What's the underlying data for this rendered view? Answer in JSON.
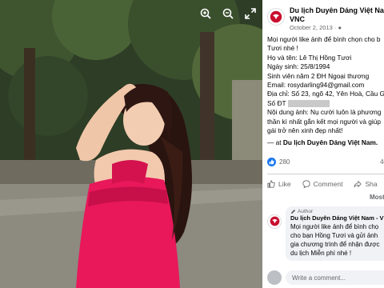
{
  "viewer": {
    "controls": [
      "zoom-in-icon",
      "zoom-out-icon",
      "fullscreen-icon"
    ]
  },
  "post": {
    "page_name_line1": "Du lịch Duyên Dáng Việt Nam -",
    "page_name_line2": "VNC",
    "date": "October 2, 2013 · ",
    "body": [
      "Mọi người like ảnh để bình chọn cho b",
      "Tươi nhé !",
      "Họ và tên: Lê Thị Hồng Tươi",
      "Ngày sinh: 25/8/1994",
      "Sinh viên năm 2 ĐH Ngoại thương",
      "Email: rosydarling94@gmail.com",
      "Địa chỉ: Số 23, ngõ 42, Yên Hoà, Cầu Gi",
      "Số ĐT",
      "Nội dung ảnh: Nụ cười luôn là phương",
      "thần kì nhất gắn kết mọi người và giúp",
      "gái trở nên xinh đẹp nhất!"
    ],
    "tagged_prefix": "— at ",
    "tagged_page": "Du lịch Duyên Dáng Việt Nam.",
    "like_count": "280",
    "share_count": "40",
    "actions": {
      "like": "Like",
      "comment": "Comment",
      "share": "Sha"
    },
    "sort_label": "Most r"
  },
  "comment": {
    "badge": "Author",
    "author": "Du lịch Duyên Dáng Việt Nam - VNC",
    "lines": [
      "Mọi người like ảnh để bình chọ",
      "cho bạn Hồng Tươi và gửi ảnh",
      "gia chương trình để nhận được",
      "du lịch Miễn phí nhé !"
    ]
  },
  "composer": {
    "placeholder": "Write a comment..."
  },
  "colors": {
    "brand_red": "#c8102e",
    "like_blue": "#1877f2",
    "dress_pink": "#e8185a"
  }
}
